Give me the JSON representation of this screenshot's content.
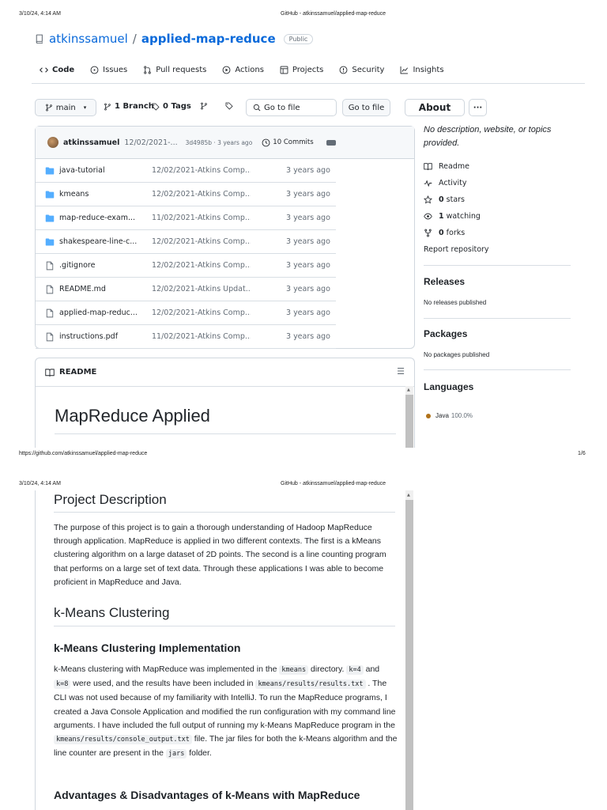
{
  "print": {
    "timestamp": "3/10/24, 4:14 AM",
    "doc_title": "GitHub - atkinssamuel/applied-map-reduce",
    "url": "https://github.com/atkinssamuel/applied-map-reduce",
    "page_num": "1/6"
  },
  "repo": {
    "owner": "atkinssamuel",
    "sep": "/",
    "name": "applied-map-reduce",
    "visibility": "Public"
  },
  "tabs": [
    {
      "label": "Code",
      "icon": "code-icon"
    },
    {
      "label": "Issues",
      "icon": "issue-icon"
    },
    {
      "label": "Pull requests",
      "icon": "pull-request-icon"
    },
    {
      "label": "Actions",
      "icon": "play-icon"
    },
    {
      "label": "Projects",
      "icon": "table-icon"
    },
    {
      "label": "Security",
      "icon": "shield-icon"
    },
    {
      "label": "Insights",
      "icon": "graph-icon"
    }
  ],
  "toolbar": {
    "branch": "main",
    "branch_count": "1 Branch",
    "tag_count": "0 Tags",
    "search_placeholder": "Go to file",
    "go_to_file": "Go to file",
    "about_label": "About",
    "more_label": "···"
  },
  "commit": {
    "author": "atkinssamuel",
    "message": "12/02/2021-...",
    "hash_age": "3d4985b · 3 years ago",
    "commits": "10 Commits"
  },
  "files": [
    {
      "name": "java-tutorial",
      "type": "dir",
      "msg": "12/02/2021-Atkins Comp...",
      "age": "3 years ago"
    },
    {
      "name": "kmeans",
      "type": "dir",
      "msg": "12/02/2021-Atkins Comp...",
      "age": "3 years ago"
    },
    {
      "name": "map-reduce-exam...",
      "type": "dir",
      "msg": "11/02/2021-Atkins Comp...",
      "age": "3 years ago"
    },
    {
      "name": "shakespeare-line-c...",
      "type": "dir",
      "msg": "12/02/2021-Atkins Comp...",
      "age": "3 years ago"
    },
    {
      "name": ".gitignore",
      "type": "file",
      "msg": "12/02/2021-Atkins Comp...",
      "age": "3 years ago"
    },
    {
      "name": "README.md",
      "type": "file",
      "msg": "12/02/2021-Atkins Updat...",
      "age": "3 years ago"
    },
    {
      "name": "applied-map-reduc...",
      "type": "file",
      "msg": "12/02/2021-Atkins Comp...",
      "age": "3 years ago"
    },
    {
      "name": "instructions.pdf",
      "type": "file",
      "msg": "11/02/2021-Atkins Comp...",
      "age": "3 years ago"
    }
  ],
  "readme": {
    "label": "README",
    "title": "MapReduce Applied"
  },
  "about": {
    "description": "No description, website, or topics provided.",
    "readme": "Readme",
    "activity": "Activity",
    "stars_num": "0",
    "stars_label": "stars",
    "watching_num": "1",
    "watching_label": "watching",
    "forks_num": "0",
    "forks_label": "forks",
    "report": "Report repository"
  },
  "releases": {
    "heading": "Releases",
    "text": "No releases published"
  },
  "packages": {
    "heading": "Packages",
    "text": "No packages published"
  },
  "languages": {
    "heading": "Languages",
    "name": "Java",
    "percent": "100.0%",
    "color": "#b07219"
  },
  "page2": {
    "h_project": "Project Description",
    "p_project": "The purpose of this project is to gain a thorough understanding of Hadoop MapReduce through application. MapReduce is applied in two different contexts. The first is a kMeans clustering algorithm on a large dataset of 2D points. The second is a line counting program that performs on a large set of text data. Through these applications I was able to become proficient in MapReduce and Java.",
    "h_kmeans": "k-Means Clustering",
    "h_impl": "k-Means Clustering Implementation",
    "impl_t1": "k-Means clustering with MapReduce was implemented in the ",
    "impl_c1": "kmeans",
    "impl_t2": " directory. ",
    "impl_c2": "k=4",
    "impl_t3": " and ",
    "impl_c3": "k=8",
    "impl_t4": " were used, and the results have been included in ",
    "impl_c4": "kmeans/results/results.txt",
    "impl_t5": " . The CLI was not used because of my familiarity with IntelliJ. To run the MapReduce programs, I created a Java Console Application and modified the run configuration with my command line arguments. I have included the full output of running my k-Means MapReduce program in the ",
    "impl_c5": "kmeans/results/console_output.txt",
    "impl_t6": " file. The jar files for both the k-Means algorithm and the line counter are present in the ",
    "impl_c6": "jars",
    "impl_t7": " folder.",
    "h_adv": "Advantages & Disadvantages of k-Means with MapReduce"
  }
}
